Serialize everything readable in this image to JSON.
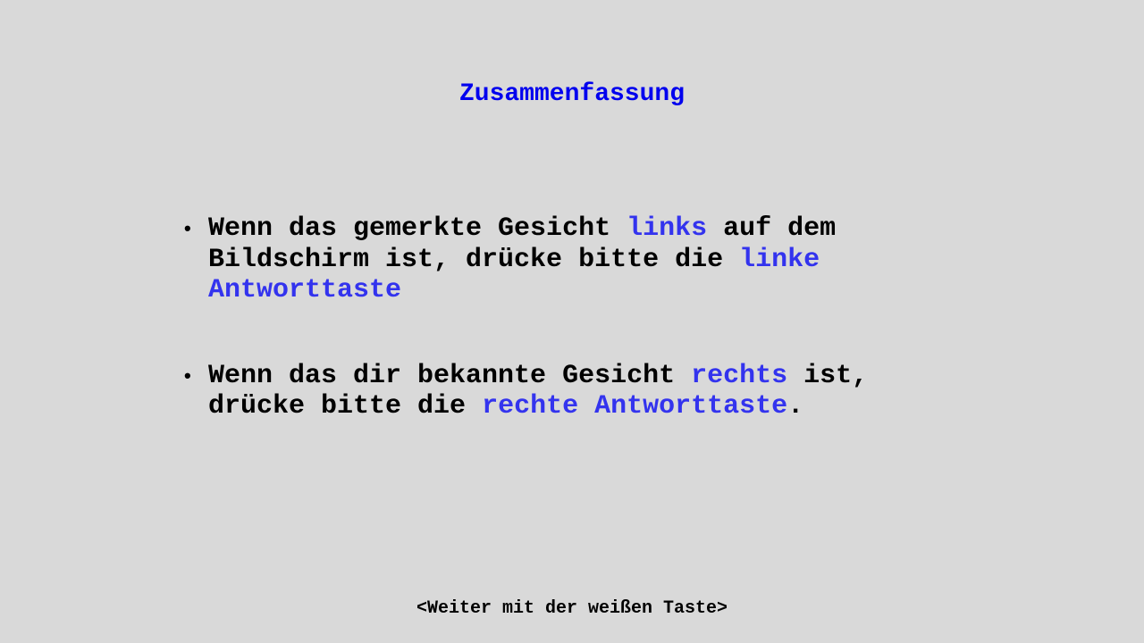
{
  "slide": {
    "title": "Zusammenfassung",
    "bullets": [
      {
        "parts": [
          "Wenn das gemerkte Gesicht ",
          "links",
          " auf dem Bildschirm ist, drücke bitte die ",
          "linke Antworttaste",
          ""
        ]
      },
      {
        "parts": [
          "Wenn das dir bekannte Gesicht ",
          "rechts",
          " ist, drücke bitte die ",
          "rechte Antworttaste",
          "."
        ]
      }
    ],
    "bullet_symbol": "•",
    "footer": "<Weiter mit der weißen Taste>"
  },
  "colors": {
    "background": "#d9d9d9",
    "title": "#0000ee",
    "highlight": "#3333ee",
    "text": "#000000"
  }
}
